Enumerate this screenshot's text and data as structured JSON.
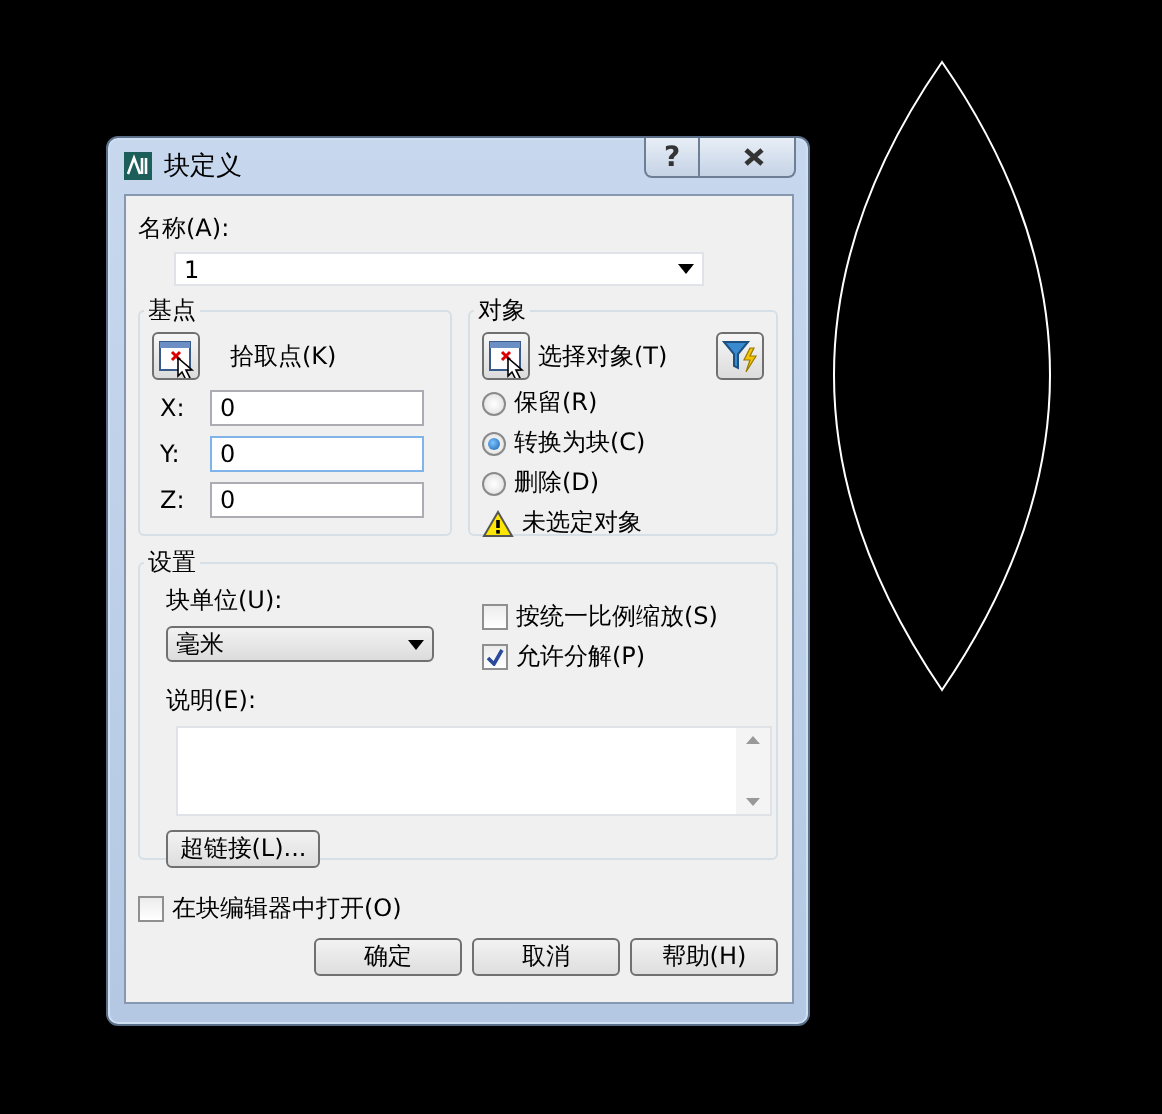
{
  "window": {
    "title": "块定义",
    "help_button": "?"
  },
  "name": {
    "label": "名称(A):",
    "value": "1"
  },
  "base_point": {
    "title": "基点",
    "pick_label": "拾取点(K)",
    "coords": [
      {
        "label": "X:",
        "value": "0",
        "focused": false
      },
      {
        "label": "Y:",
        "value": "0",
        "focused": true
      },
      {
        "label": "Z:",
        "value": "0",
        "focused": false
      }
    ]
  },
  "objects": {
    "title": "对象",
    "select_label": "选择对象(T)",
    "options": [
      {
        "label": "保留(R)",
        "selected": false
      },
      {
        "label": "转换为块(C)",
        "selected": true
      },
      {
        "label": "删除(D)",
        "selected": false
      }
    ],
    "warning": "未选定对象"
  },
  "settings": {
    "title": "设置",
    "unit_label": "块单位(U):",
    "unit_value": "毫米",
    "checks": [
      {
        "label": "按统一比例缩放(S)",
        "checked": false
      },
      {
        "label": "允许分解(P)",
        "checked": true
      }
    ],
    "description_label": "说明(E):",
    "hyperlink_button": "超链接(L)..."
  },
  "open_in_editor": {
    "label": "在块编辑器中打开(O)",
    "checked": false
  },
  "buttons": [
    "确定",
    "取消",
    "帮助(H)"
  ]
}
